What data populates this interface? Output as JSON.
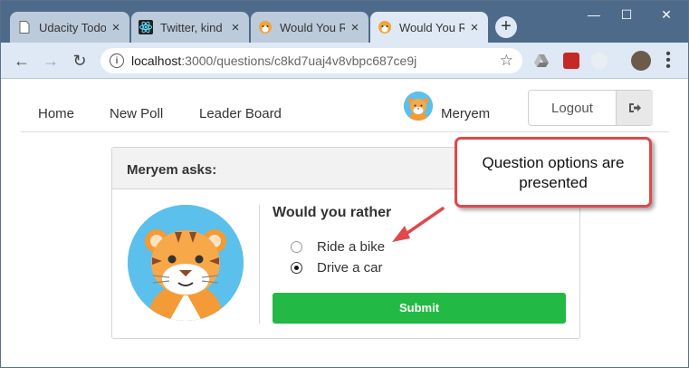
{
  "browser": {
    "tabs": [
      {
        "title": "Udacity Todo",
        "active": false
      },
      {
        "title": "Twitter, kind",
        "active": false
      },
      {
        "title": "Would You R",
        "active": false
      },
      {
        "title": "Would You R",
        "active": true
      }
    ],
    "new_tab_label": "+",
    "url": {
      "host": "localhost",
      "path": ":3000/questions/c8kd7uaj4v8vbpc687ce9j"
    }
  },
  "nav": {
    "links": [
      "Home",
      "New Poll",
      "Leader Board"
    ],
    "user_name": "Meryem",
    "logout_label": "Logout"
  },
  "card": {
    "header": "Meryem asks:",
    "question": "Would you rather",
    "options": [
      {
        "label": "Ride a bike",
        "selected": false
      },
      {
        "label": "Drive a car",
        "selected": true
      }
    ],
    "submit_label": "Submit"
  },
  "annotation": {
    "text": "Question options are presented"
  },
  "colors": {
    "submit": "#22ba45",
    "callout_border": "#e0484c",
    "arrow": "#e0484c",
    "tabstrip": "#4e6a8b",
    "avatar_bg": "#5bc0eb"
  }
}
